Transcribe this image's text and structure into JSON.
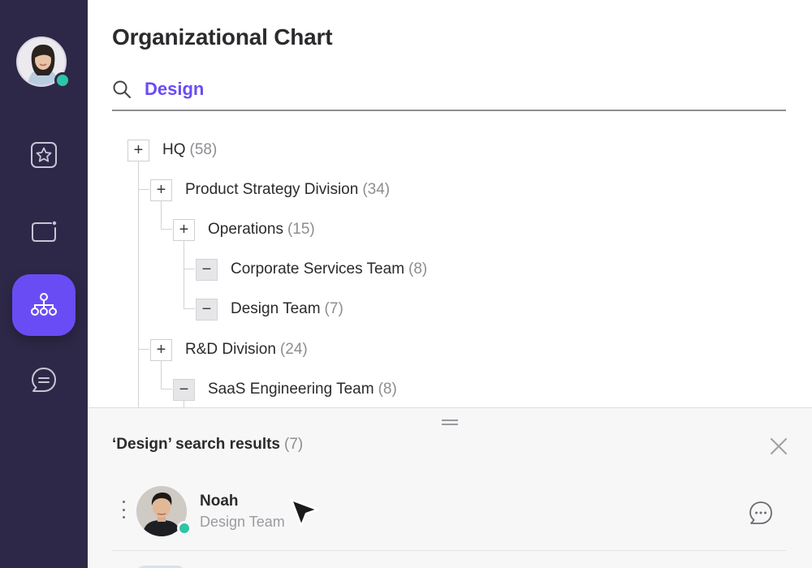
{
  "user": {
    "avatar_alt": "user avatar",
    "status_color": "#2ec4a6"
  },
  "sidebar": {
    "items": [
      {
        "name": "favorites",
        "icon": "star-icon",
        "active": false
      },
      {
        "name": "messages-box",
        "icon": "notification-box-icon",
        "active": false
      },
      {
        "name": "org-chart",
        "icon": "org-chart-icon",
        "active": true
      },
      {
        "name": "chat",
        "icon": "chat-bubble-icon",
        "active": false
      }
    ],
    "accent": "#6a4cf5",
    "background": "#2e2848"
  },
  "header": {
    "title": "Organizational Chart"
  },
  "search": {
    "value": "Design",
    "icon": "search-icon"
  },
  "tree": {
    "nodes": [
      {
        "label": "HQ",
        "count": "(58)",
        "toggle": "+",
        "level": 0
      },
      {
        "label": "Product Strategy Division",
        "count": "(34)",
        "toggle": "+",
        "level": 1
      },
      {
        "label": "Operations",
        "count": "(15)",
        "toggle": "+",
        "level": 2
      },
      {
        "label": "Corporate Services Team",
        "count": "(8)",
        "toggle": "−",
        "level": 3
      },
      {
        "label": "Design Team",
        "count": "(7)",
        "toggle": "−",
        "level": 3
      },
      {
        "label": "R&D Division",
        "count": "(24)",
        "toggle": "+",
        "level": 1
      },
      {
        "label": "SaaS Engineering Team",
        "count": "(8)",
        "toggle": "−",
        "level": 2
      }
    ]
  },
  "results": {
    "title": "‘Design’ search results",
    "count": "(7)",
    "items": [
      {
        "name": "Noah",
        "team": "Design Team",
        "status_color": "#2ec4a6"
      }
    ]
  }
}
